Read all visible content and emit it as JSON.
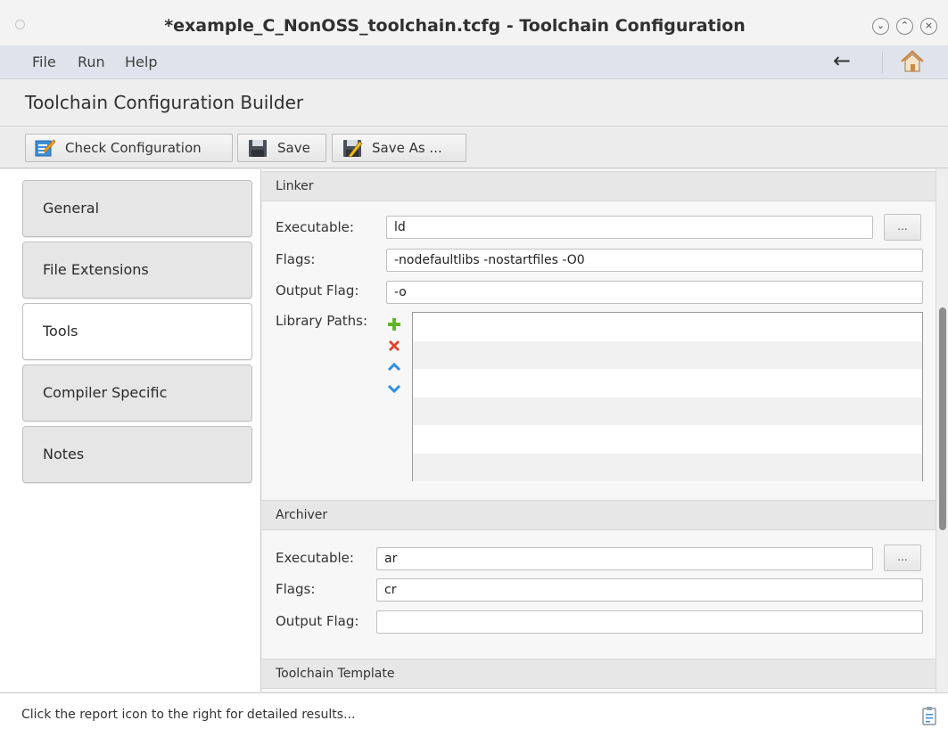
{
  "window": {
    "title": "*example_C_NonOSS_toolchain.tcfg - Toolchain Configuration",
    "buttons": {
      "minimize": "⌄",
      "maximize": "⌃",
      "close": "×"
    }
  },
  "menu": {
    "items": [
      "File",
      "Run",
      "Help"
    ],
    "back_glyph": "←",
    "back_icon": "arrow-left-icon",
    "home_icon": "home-icon"
  },
  "heading": "Toolchain Configuration Builder",
  "toolbar": {
    "check_label": "Check Configuration",
    "save_label": "Save",
    "save_as_label": "Save As ..."
  },
  "sidebar": {
    "items": [
      "General",
      "File Extensions",
      "Tools",
      "Compiler Specific",
      "Notes"
    ],
    "active": "Tools"
  },
  "linker": {
    "header": "Linker",
    "executable_label": "Executable:",
    "executable_value": "ld",
    "flags_label": "Flags:",
    "flags_value": "-nodefaultlibs -nostartfiles -O0",
    "output_flag_label": "Output Flag:",
    "output_flag_value": "-o",
    "library_paths_label": "Library Paths:",
    "browse_label": "...",
    "library_paths": []
  },
  "archiver": {
    "header": "Archiver",
    "executable_label": "Executable:",
    "executable_value": "ar",
    "flags_label": "Flags:",
    "flags_value": "cr",
    "output_flag_label": "Output Flag:",
    "output_flag_value": "",
    "browse_label": "..."
  },
  "template": {
    "header": "Toolchain Template"
  },
  "status": {
    "message": "Click the report icon to the right for detailed results..."
  },
  "colors": {
    "add": "#5fb526",
    "remove": "#e0442a",
    "arrows": "#2f8fe0",
    "menubar": "#dfe4ec"
  }
}
